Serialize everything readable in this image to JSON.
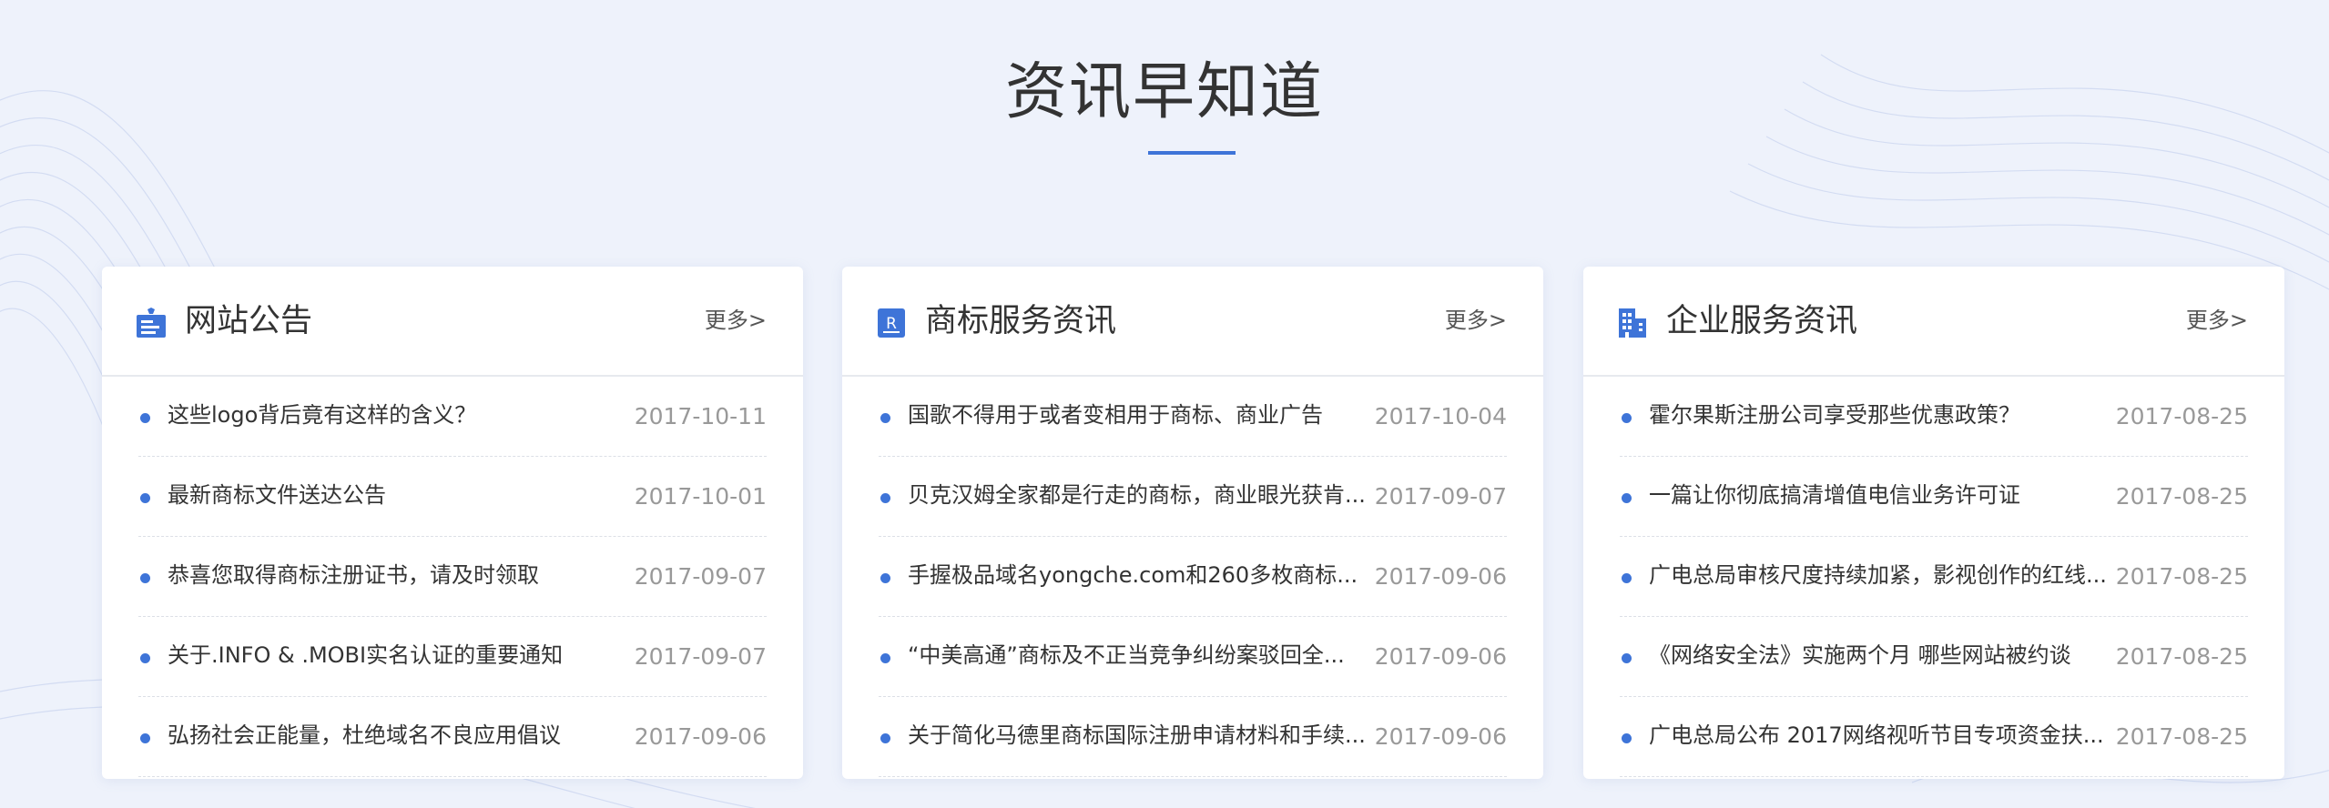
{
  "section": {
    "title": "资讯早知道"
  },
  "colors": {
    "accent": "#3e74d8",
    "background": "#eef2fb",
    "card": "#ffffff",
    "date": "#999999"
  },
  "cards": [
    {
      "title": "网站公告",
      "icon": "announcement-icon",
      "more": "更多>",
      "items": [
        {
          "title": "这些logo背后竟有这样的含义？",
          "date": "2017-10-11"
        },
        {
          "title": "最新商标文件送达公告",
          "date": "2017-10-01"
        },
        {
          "title": "恭喜您取得商标注册证书，请及时领取",
          "date": "2017-09-07"
        },
        {
          "title": "关于.INFO & .MOBI实名认证的重要通知",
          "date": "2017-09-07"
        },
        {
          "title": "弘扬社会正能量，杜绝域名不良应用倡议",
          "date": "2017-09-06"
        }
      ]
    },
    {
      "title": "商标服务资讯",
      "icon": "trademark-r-icon",
      "more": "更多>",
      "items": [
        {
          "title": "国歌不得用于或者变相用于商标、商业广告",
          "date": "2017-10-04"
        },
        {
          "title": "贝克汉姆全家都是行走的商标，商业眼光获肯...",
          "date": "2017-09-07"
        },
        {
          "title": "手握极品域名yongche.com和260多枚商标...",
          "date": "2017-09-06"
        },
        {
          "title": "“中美高通”商标及不正当竞争纠纷案驳回全...",
          "date": "2017-09-06"
        },
        {
          "title": "关于简化马德里商标国际注册申请材料和手续...",
          "date": "2017-09-06"
        }
      ]
    },
    {
      "title": "企业服务资讯",
      "icon": "building-icon",
      "more": "更多>",
      "items": [
        {
          "title": "霍尔果斯注册公司享受那些优惠政策？",
          "date": "2017-08-25"
        },
        {
          "title": "一篇让你彻底搞清增值电信业务许可证",
          "date": "2017-08-25"
        },
        {
          "title": "广电总局审核尺度持续加紧，影视创作的红线...",
          "date": "2017-08-25"
        },
        {
          "title": "《网络安全法》实施两个月 哪些网站被约谈",
          "date": "2017-08-25"
        },
        {
          "title": "广电总局公布 2017网络视听节目专项资金扶...",
          "date": "2017-08-25"
        }
      ]
    }
  ]
}
